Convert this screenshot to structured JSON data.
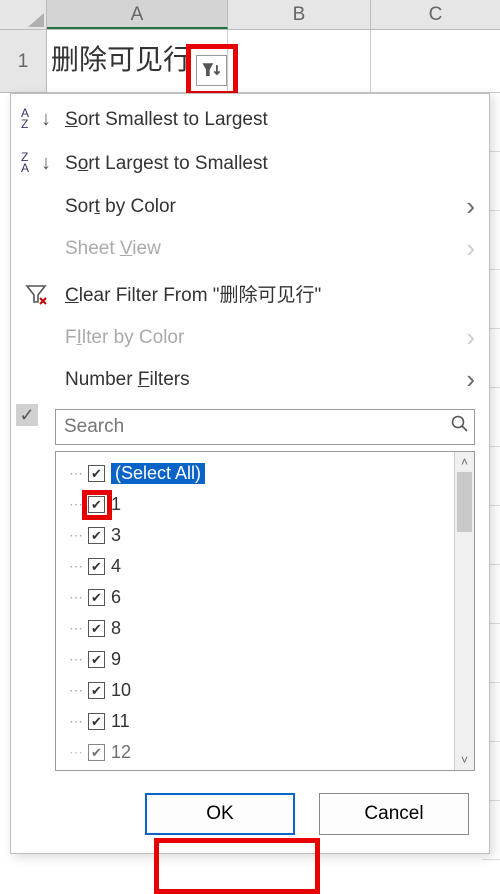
{
  "grid": {
    "columns": [
      "A",
      "B",
      "C"
    ],
    "row_number": "1",
    "a1_value": "删除可见行"
  },
  "menu": {
    "sort_asc": "Sort Smallest to Largest",
    "sort_desc": "Sort Largest to Smallest",
    "sort_color": "Sort by Color",
    "sheet_view": "Sheet View",
    "clear_filter": "Clear Filter From \"删除可见行\"",
    "filter_color": "Filter by Color",
    "number_filters": "Number Filters"
  },
  "hotkeys": {
    "sort_asc": "S",
    "sort_desc": "o",
    "sort_color": "t",
    "sheet_view": "V",
    "clear_filter": "C",
    "filter_color": "I",
    "number_filters": "F"
  },
  "search": {
    "placeholder": "Search"
  },
  "checklist": {
    "select_all": "(Select All)",
    "items": [
      "1",
      "3",
      "4",
      "6",
      "8",
      "9",
      "10",
      "11",
      "12"
    ]
  },
  "buttons": {
    "ok": "OK",
    "cancel": "Cancel"
  }
}
